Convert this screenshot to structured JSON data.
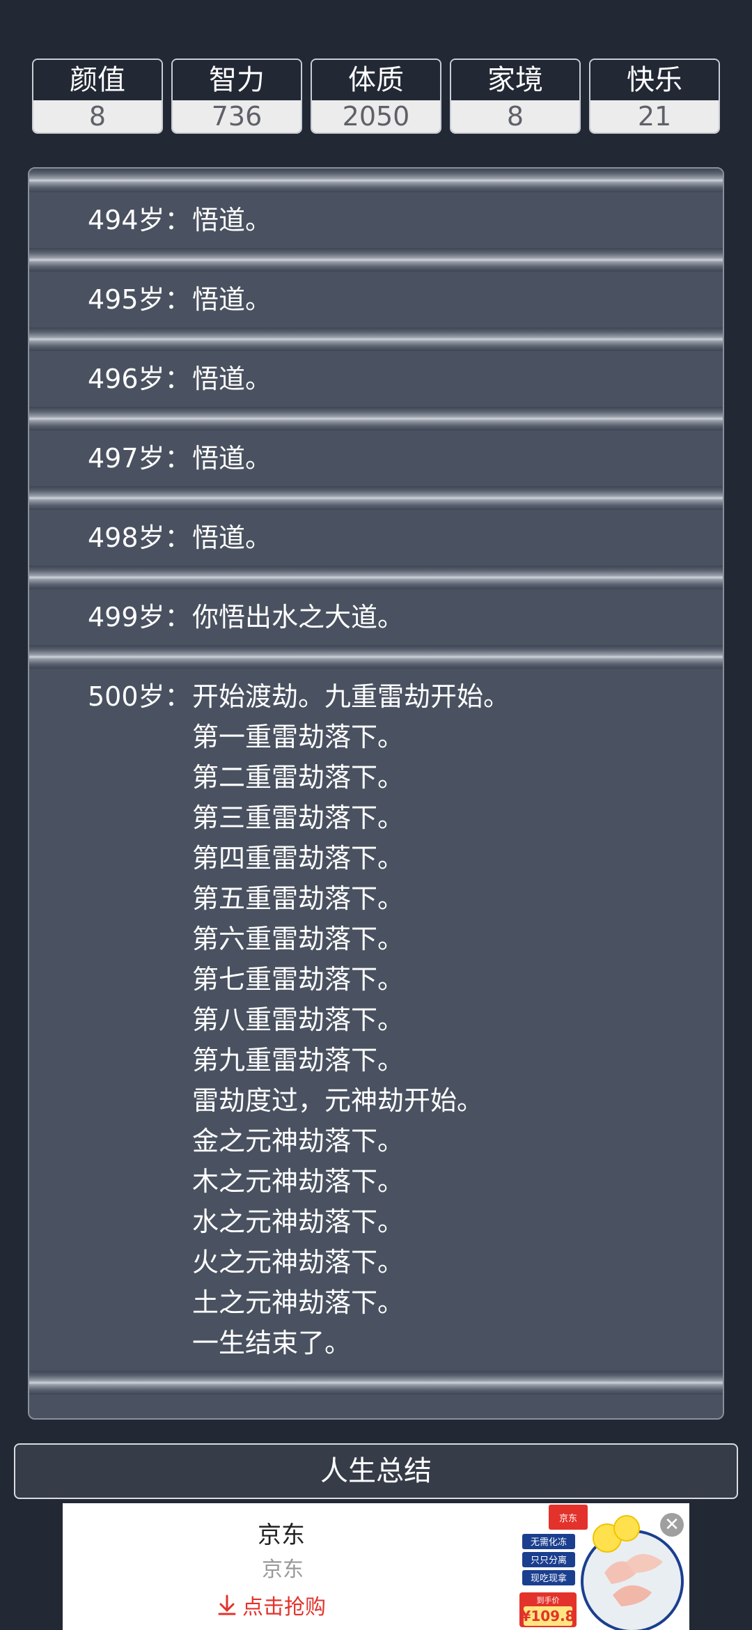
{
  "properties": [
    {
      "name": "颜值",
      "value": "8"
    },
    {
      "name": "智力",
      "value": "736"
    },
    {
      "name": "体质",
      "value": "2050"
    },
    {
      "name": "家境",
      "value": "8"
    },
    {
      "name": "快乐",
      "value": "21"
    }
  ],
  "log": [
    {
      "age": "494岁：",
      "lines": [
        "悟道。"
      ]
    },
    {
      "age": "495岁：",
      "lines": [
        "悟道。"
      ]
    },
    {
      "age": "496岁：",
      "lines": [
        "悟道。"
      ]
    },
    {
      "age": "497岁：",
      "lines": [
        "悟道。"
      ]
    },
    {
      "age": "498岁：",
      "lines": [
        "悟道。"
      ]
    },
    {
      "age": "499岁：",
      "lines": [
        "你悟出水之大道。"
      ]
    },
    {
      "age": "500岁：",
      "lines": [
        "开始渡劫。九重雷劫开始。",
        "第一重雷劫落下。",
        "第二重雷劫落下。",
        "第三重雷劫落下。",
        "第四重雷劫落下。",
        "第五重雷劫落下。",
        "第六重雷劫落下。",
        "第七重雷劫落下。",
        "第八重雷劫落下。",
        "第九重雷劫落下。",
        "雷劫度过，元神劫开始。",
        "金之元神劫落下。",
        "木之元神劫落下。",
        "水之元神劫落下。",
        "火之元神劫落下。",
        "土之元神劫落下。",
        "一生结束了。"
      ]
    }
  ],
  "summary_button": "人生总结",
  "ad": {
    "title": "京东",
    "subtitle": "京东",
    "cta": "点击抢购",
    "logo_text": "京东",
    "tags": [
      "无需化冻",
      "只只分离",
      "现吃现拿"
    ],
    "price_label": "到手价",
    "price": "¥109.8",
    "close_icon": "close-icon",
    "cta_icon": "download-arrow-icon"
  }
}
